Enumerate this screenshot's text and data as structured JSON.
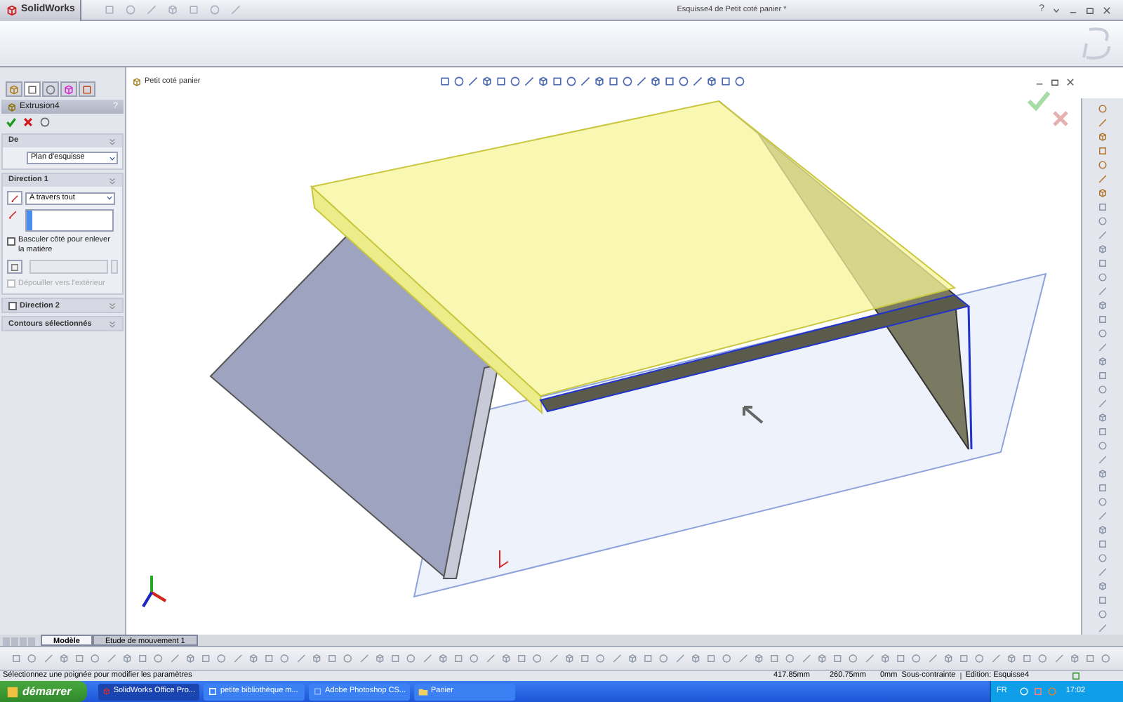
{
  "app": {
    "logo": "SolidWorks",
    "title": "Esquisse4 de Petit coté panier *",
    "help": "?"
  },
  "property_manager": {
    "tabs": [
      {
        "selected": false
      },
      {
        "selected": true
      },
      {
        "selected": false
      },
      {
        "selected": false
      },
      {
        "selected": false
      }
    ],
    "title": "Extrusion4",
    "help": "?",
    "from": {
      "title": "De",
      "value": "Plan d'esquisse"
    },
    "direction1": {
      "title": "Direction 1",
      "end_condition": "A travers tout",
      "flip_label": "Basculer côté pour enlever la matière",
      "flip_checked": false,
      "draft_label": "Dépouiller vers l'extérieur",
      "draft_disabled": true
    },
    "direction2": {
      "title": "Direction 2",
      "checked": false
    },
    "contours": {
      "title": "Contours sélectionnés"
    }
  },
  "viewport": {
    "tree_label": "Petit coté panier"
  },
  "bottom_tabs": [
    {
      "label": "Modèle",
      "selected": true
    },
    {
      "label": "Etude de mouvement 1",
      "selected": false
    }
  ],
  "status_bar": {
    "message": "Sélectionnez une poignée pour modifier les paramètres",
    "x": "417.85mm",
    "y": "260.75mm",
    "z": "0mm",
    "state": "Sous-contrainte",
    "mode": "Edition: Esquisse4"
  },
  "taskbar": {
    "start": "démarrer",
    "tasks": [
      {
        "label": "SolidWorks Office Pro...",
        "selected": true
      },
      {
        "label": "petite bibliothèque m...",
        "selected": false
      },
      {
        "label": "Adobe Photoshop CS...",
        "selected": false
      },
      {
        "label": "Panier",
        "selected": false
      }
    ],
    "language": "FR",
    "clock": "17:02"
  }
}
